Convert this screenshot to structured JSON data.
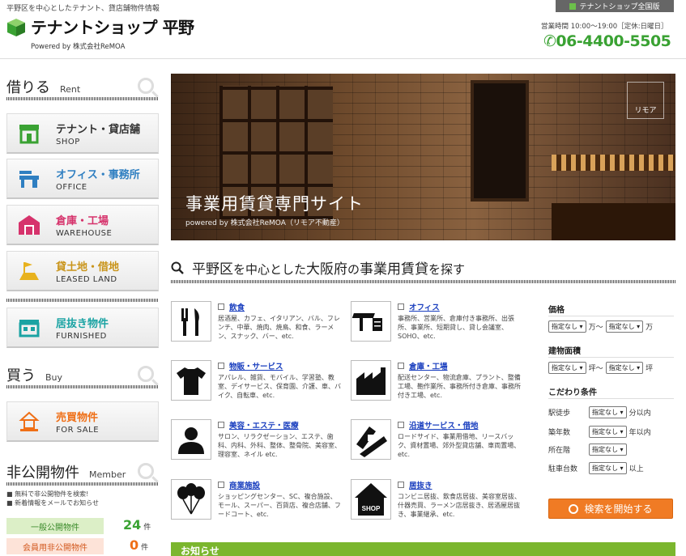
{
  "header": {
    "tagline": "平野区を中心としたテナント、貸店舗物件情報",
    "brand": "テナントショップ 平野",
    "powered": "Powered by 株式会社ReMOA",
    "network_button": "テナントショップ全国版",
    "hours": "営業時間 10:00～19:00［定休:日曜日］",
    "phone": "06-4400-5505"
  },
  "sidebar": {
    "rent": {
      "jp": "借りる",
      "en": "Rent"
    },
    "rent_items": [
      {
        "label": "テナント・貸店舗",
        "en": "SHOP",
        "icon": "shop-icon"
      },
      {
        "label": "オフィス・事務所",
        "en": "OFFICE",
        "icon": "office-icon"
      },
      {
        "label": "倉庫・工場",
        "en": "WAREHOUSE",
        "icon": "warehouse-icon"
      },
      {
        "label": "貸土地・借地",
        "en": "LEASED LAND",
        "icon": "land-icon"
      },
      {
        "label": "居抜き物件",
        "en": "FURNISHED",
        "icon": "furnished-icon"
      }
    ],
    "buy": {
      "jp": "買う",
      "en": "Buy"
    },
    "buy_items": [
      {
        "label": "売買物件",
        "en": "FOR SALE",
        "icon": "house-icon"
      }
    ],
    "member": {
      "jp": "非公開物件",
      "en": "Member"
    },
    "member_notes": [
      "■ 無料で非公開物件を検索!",
      "■ 新着情報をメールでお知らせ"
    ],
    "stats": [
      {
        "label": "一般公開物件",
        "count": "24",
        "unit": "件"
      },
      {
        "label": "会員用非公開物件",
        "count": "0",
        "unit": "件"
      }
    ]
  },
  "hero": {
    "title": "事業用賃貸専門サイト",
    "subtitle": "powered by 株式会社ReMOA（リモア不動産）",
    "badge": "リモア"
  },
  "search": {
    "heading_prefix": "平野区",
    "heading_mid": "を中心とした",
    "heading_pref": "大阪府",
    "heading_mid2": "の",
    "heading_kw": "事業用賃貸",
    "heading_suffix": "を探す",
    "categories": [
      {
        "name": "飲食",
        "desc": "居酒屋、カフェ、イタリアン、バル、フレンチ、中華、焼肉、焼鳥、和食、ラーメン、スナック、バー、etc.",
        "icon": "knife-fork-icon"
      },
      {
        "name": "オフィス",
        "desc": "事務所、営業所、倉庫付き事務所、出張所、事業所、短期貸し、貸し会議室、SOHO、etc.",
        "icon": "desk-icon"
      },
      {
        "name": "物販・サービス",
        "desc": "アパレル、雑貨、モバイル、学習塾、教室、デイサービス、保育園、介護、車、バイク、自転車、etc.",
        "icon": "tshirt-icon"
      },
      {
        "name": "倉庫・工場",
        "desc": "配送センター、物流倉庫、プラント、整備工場、鞄作業所、事務所付き倉庫、事務所付き工場、etc.",
        "icon": "factory-icon"
      },
      {
        "name": "美容・エステ・医療",
        "desc": "サロン、リラクゼーション、エステ、歯科、内科、外科、整体、整骨院、美容室、理容室、ネイル etc.",
        "icon": "person-icon"
      },
      {
        "name": "沿道サービス・借地",
        "desc": "ロードサイド、事業用借地、リースバック、資材置場、郊外型貸店舗、車両置場、etc.",
        "icon": "road-icon"
      },
      {
        "name": "商業施設",
        "desc": "ショッピングセンター、SC、複合施設、モール、スーパー、百貨店、複合店舗、フードコート、etc.",
        "icon": "balloon-icon"
      },
      {
        "name": "居抜き",
        "desc": "コンビニ居抜、飲食店居抜、美容室居抜、什器売買、ラーメン店居抜き、居酒屋居抜き、事業継承、etc.",
        "icon": "shop-house-icon"
      }
    ]
  },
  "filters": {
    "price": {
      "label": "価格",
      "from": "指定なし",
      "mid": "万～",
      "to": "指定なし",
      "unit": "万"
    },
    "area": {
      "label": "建物面積",
      "from": "指定なし",
      "mid": "坪～",
      "to": "指定なし",
      "unit": "坪"
    },
    "features": {
      "label": "こだわり条件",
      "rows": [
        {
          "label": "駅徒歩",
          "value": "指定なし",
          "unit": "分以内"
        },
        {
          "label": "築年数",
          "value": "指定なし",
          "unit": "年以内"
        },
        {
          "label": "所在階",
          "value": "指定なし",
          "unit": ""
        },
        {
          "label": "駐車台数",
          "value": "指定なし",
          "unit": "以上"
        }
      ]
    },
    "search_button": "検索を開始する"
  },
  "news": {
    "title": "お知らせ"
  },
  "colors": {
    "brand_green": "#3aa233",
    "accent_orange": "#f07b24",
    "bar_green": "#7bb62e"
  }
}
